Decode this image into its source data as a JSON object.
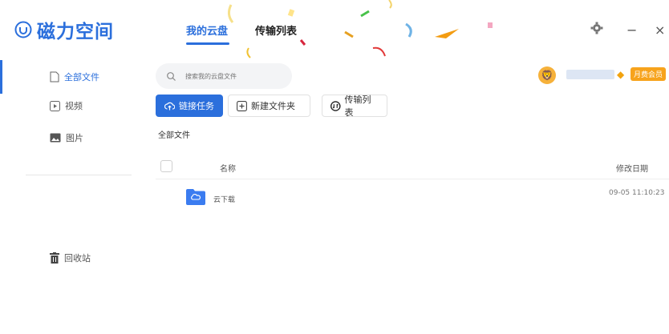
{
  "header": {
    "brand": "磁力空间",
    "tabs": [
      {
        "label": "我的云盘",
        "active": true
      },
      {
        "label": "传输列表",
        "active": false
      }
    ],
    "window_controls": {
      "minimize": "−",
      "close": "×"
    }
  },
  "sidebar": {
    "items": [
      {
        "label": "全部文件",
        "icon": "file-icon",
        "active": true
      },
      {
        "label": "视频",
        "icon": "video-icon",
        "active": false
      },
      {
        "label": "图片",
        "icon": "image-icon",
        "active": false
      }
    ],
    "trash_label": "回收站"
  },
  "search": {
    "placeholder": "搜索我的云盘文件"
  },
  "user": {
    "vip_badge": "月费会员"
  },
  "toolbar": {
    "link_task": "链接任务",
    "new_folder": "新建文件夹",
    "transfer_list": "传输列表"
  },
  "breadcrumb": "全部文件",
  "table": {
    "headers": {
      "name": "名称",
      "date": "修改日期"
    },
    "rows": [
      {
        "name": "云下载",
        "modified": "09-05 11:10:23",
        "icon": "cloud-folder-icon"
      }
    ]
  },
  "colors": {
    "accent": "#2b6fdc",
    "vip": "#f7a31c"
  }
}
